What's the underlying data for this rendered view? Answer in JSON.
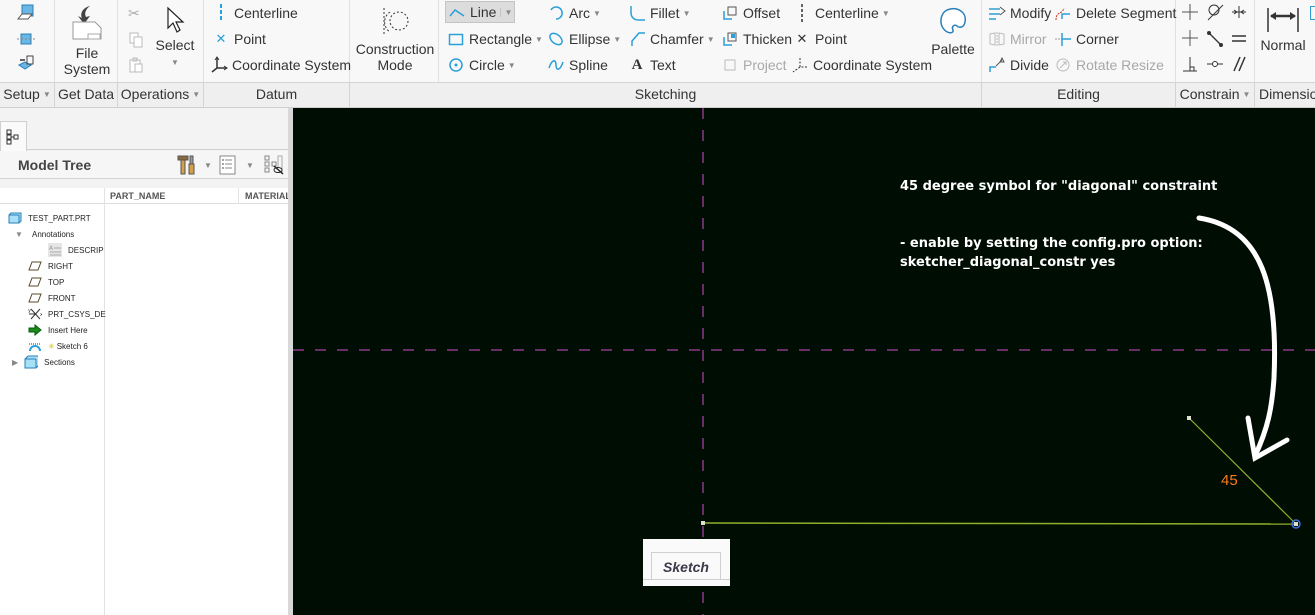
{
  "ribbon": {
    "setup": {
      "label": "Setup"
    },
    "get_data": {
      "label": "Get Data",
      "file_system": [
        "File",
        "System"
      ]
    },
    "operations": {
      "label": "Operations",
      "select": "Select"
    },
    "datum": {
      "label": "Datum",
      "centerline": "Centerline",
      "point": "Point",
      "coordinate_system": "Coordinate System"
    },
    "construction_mode": [
      "Construction",
      "Mode"
    ],
    "sketching": {
      "label": "Sketching",
      "line": "Line",
      "rectangle": "Rectangle",
      "circle": "Circle",
      "arc": "Arc",
      "ellipse": "Ellipse",
      "spline": "Spline",
      "fillet": "Fillet",
      "chamfer": "Chamfer",
      "text": "Text",
      "offset": "Offset",
      "thicken": "Thicken",
      "project": "Project",
      "centerline": "Centerline",
      "point": "Point",
      "coordinate_system": "Coordinate System",
      "palette": "Palette"
    },
    "editing": {
      "label": "Editing",
      "modify": "Modify",
      "delete_segment": "Delete Segment",
      "mirror": "Mirror",
      "corner": "Corner",
      "divide": "Divide",
      "rotate_resize": "Rotate Resize"
    },
    "constrain": {
      "label": "Constrain"
    },
    "dimension": {
      "label": "Dimension",
      "normal": "Normal"
    }
  },
  "model_tree": {
    "title": "Model Tree",
    "columns": [
      "PART_NAME",
      "MATERIAL"
    ],
    "items": [
      {
        "label": "TEST_PART.PRT",
        "icon": "part-icon"
      },
      {
        "label": "Annotations",
        "icon": "expanded-triangle-icon"
      },
      {
        "label": "DESCRIP",
        "icon": "note-icon"
      },
      {
        "label": "RIGHT",
        "icon": "datum-plane-icon"
      },
      {
        "label": "TOP",
        "icon": "datum-plane-icon"
      },
      {
        "label": "FRONT",
        "icon": "datum-plane-icon"
      },
      {
        "label": "PRT_CSYS_DE",
        "icon": "csys-icon"
      },
      {
        "label": "Insert Here",
        "icon": "insert-arrow-icon"
      },
      {
        "label": "Sketch 6",
        "icon": "sketch-icon"
      },
      {
        "label": "Sections",
        "icon": "sections-icon"
      }
    ]
  },
  "canvas": {
    "annotation_title": "45 degree symbol for \"diagonal\" constraint",
    "annotation_line1": "- enable by setting the config.pro option:",
    "annotation_line2": "sketcher_diagonal_constr yes",
    "dimension_value": "45",
    "sketch_tab": "Sketch",
    "colors": {
      "background": "#000d03",
      "geometry": "#8fb02c",
      "centerline": "#8a3a8a",
      "dimension": "#ff7a1a",
      "selected_vertex": "#3a6fd8"
    }
  }
}
